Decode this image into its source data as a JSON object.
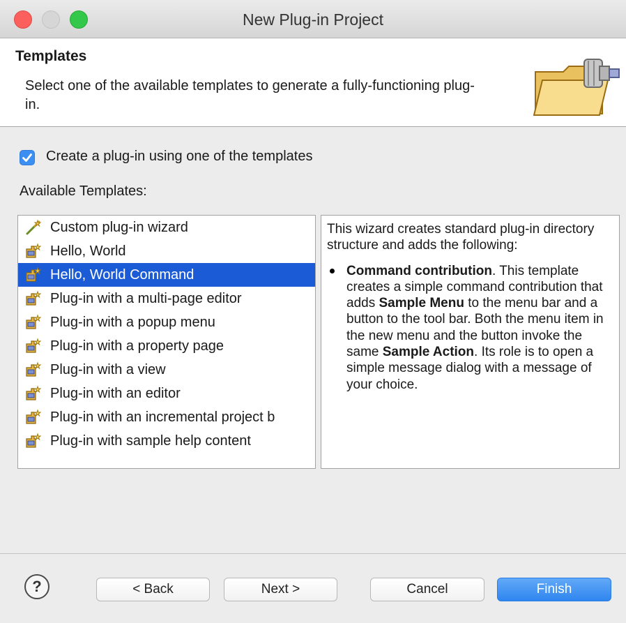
{
  "window": {
    "title": "New Plug-in Project"
  },
  "banner": {
    "title": "Templates",
    "description": "Select one of the available templates to generate a fully-functioning plug-in."
  },
  "options": {
    "use_template_label": "Create a plug-in using one of the templates",
    "use_template_checked": true
  },
  "templates": {
    "label": "Available Templates:",
    "selected_index": 2,
    "items": [
      {
        "label": "Custom plug-in wizard",
        "icon": "wizard-icon"
      },
      {
        "label": "Hello, World",
        "icon": "plugin-template-icon"
      },
      {
        "label": "Hello, World Command",
        "icon": "plugin-template-icon"
      },
      {
        "label": "Plug-in with a multi-page editor",
        "icon": "plugin-template-icon"
      },
      {
        "label": "Plug-in with a popup menu",
        "icon": "plugin-template-icon"
      },
      {
        "label": "Plug-in with a property page",
        "icon": "plugin-template-icon"
      },
      {
        "label": "Plug-in with a view",
        "icon": "plugin-template-icon"
      },
      {
        "label": "Plug-in with an editor",
        "icon": "plugin-template-icon"
      },
      {
        "label": "Plug-in with an incremental project b",
        "icon": "plugin-template-icon"
      },
      {
        "label": "Plug-in with sample help content",
        "icon": "plugin-template-icon"
      }
    ]
  },
  "description": {
    "intro": "This wizard creates standard plug-in directory structure and adds the following:",
    "bullet": {
      "term": "Command contribution",
      "text1": ". This template creates a simple command contribution that adds ",
      "bold1": "Sample Menu",
      "text2": " to the menu bar and a button to the tool bar. Both the menu item in the new menu and the button invoke the same ",
      "bold2": "Sample Action",
      "text3": ". Its role is to open a simple message dialog with a message of your choice."
    }
  },
  "buttons": {
    "help": "?",
    "back": "< Back",
    "next": "Next >",
    "cancel": "Cancel",
    "finish": "Finish"
  }
}
